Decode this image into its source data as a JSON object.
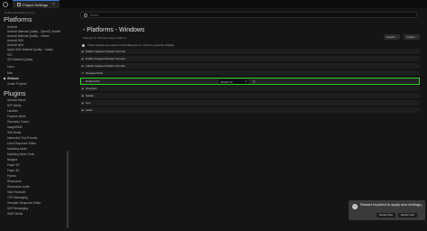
{
  "window": {
    "tab_title": "Project Settings",
    "close_symbol": "×"
  },
  "sidebar": {
    "breadcrumb": "Default Scalability (Linux)",
    "platforms_header": "Platforms",
    "platforms": [
      "Android",
      "Android Material Quality - OpenGL Mobile",
      "Android Material Quality - Vulkan",
      "Android SDK",
      "Android NDK",
      "Apple SDK Material Quality - Vulkan",
      "iOS",
      "iOS Material Quality",
      "Linux",
      "Mac",
      "Windows",
      "Xcode Projects"
    ],
    "active_platform": "Windows",
    "plugins_header": "Plugins",
    "plugins": [
      "Android Movie",
      "AVF Media",
      "Landline",
      "Fracture Mode",
      "Geometry Cache",
      "ImageWMS",
      "IMS Media",
      "Interactive Tool Presets",
      "Level Sequence Editor",
      "Modeling Mode",
      "Modeling Mode Tools",
      "Niagara",
      "Paper 2D",
      "Paper 3D",
      "Python",
      "Resonance",
      "Resonance Audio",
      "Take Recorder",
      "TCP Messaging",
      "Template Sequence Editor",
      "UDP Messaging",
      "WMF Media"
    ]
  },
  "main": {
    "search_placeholder": "Search",
    "title": "- Platforms - Windows",
    "subtitle": "Settings for Windows target platform",
    "export_label": "Export...",
    "import_label": "Import...",
    "notice": "These settings are saved in DefaultEngine.ini, which is currently writable.",
    "rows": [
      {
        "label": "D3D12 Targeted Shader Formats",
        "expanded": false
      },
      {
        "label": "D3D11 Targeted Shader Formats",
        "expanded": false
      },
      {
        "label": "Vulkan Targeted Shader Formats",
        "expanded": false
      },
      {
        "label": "Targeted RHIs",
        "expanded": true
      },
      {
        "label": "Default RHI",
        "value": "DirectX 12"
      },
      {
        "label": "Toolchain",
        "expanded": false
      },
      {
        "label": "Splash",
        "expanded": false
      },
      {
        "label": "Icon",
        "expanded": false
      },
      {
        "label": "Audio",
        "expanded": false
      }
    ]
  },
  "toast": {
    "message": "Restart required to apply new settings",
    "restart_now": "Restart Now",
    "restart_later": "Restart Later",
    "icon_glyph": "!"
  },
  "colors": {
    "highlight": "#2ed02e",
    "accent": "#2f7dd6",
    "background": "#151515"
  }
}
